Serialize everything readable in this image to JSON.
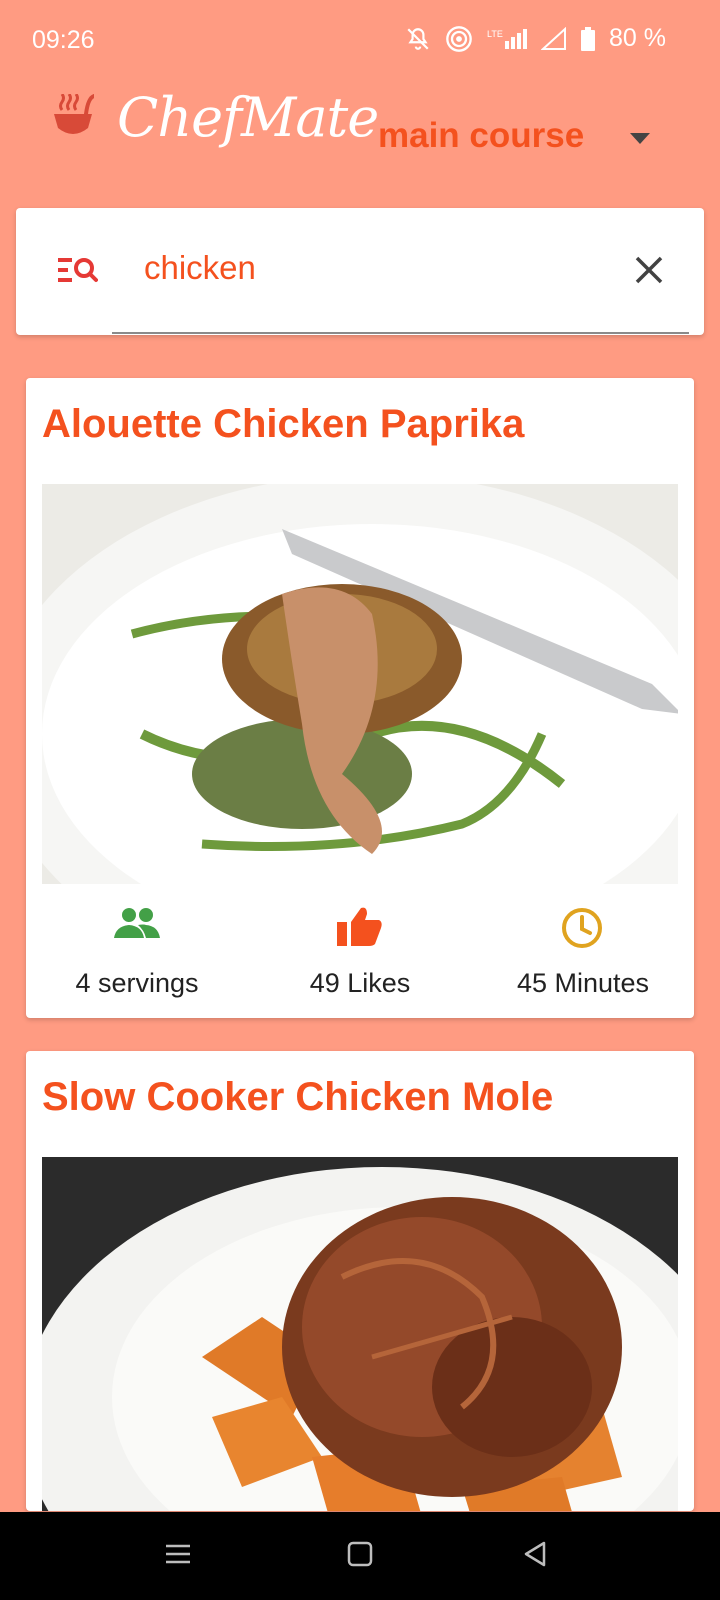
{
  "status_bar": {
    "time": "09:26",
    "battery": "80 %",
    "icons": [
      "mute-icon",
      "hotspot-icon",
      "lte-signal-icon",
      "wifi-signal-icon",
      "battery-icon"
    ]
  },
  "header": {
    "app_title": "ChefMate",
    "category": "main course",
    "colors": {
      "background": "#FF9B82",
      "accent": "#F4511E"
    }
  },
  "search": {
    "value": "chicken",
    "placeholder": ""
  },
  "recipes": [
    {
      "title": "Alouette Chicken Paprika",
      "servings": "4 servings",
      "likes": "49 Likes",
      "time": "45 Minutes"
    },
    {
      "title": "Slow Cooker Chicken Mole"
    }
  ],
  "nav": {
    "icons": [
      "menu-icon",
      "home-icon",
      "back-icon"
    ]
  }
}
